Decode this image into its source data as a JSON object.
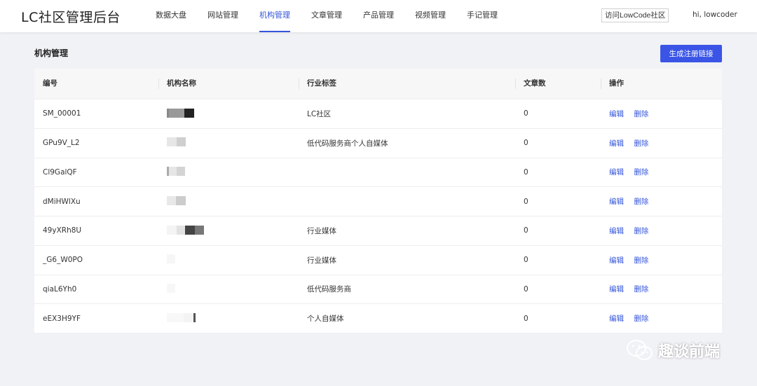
{
  "header": {
    "logo": "LC社区管理后台",
    "nav": [
      "数据大盘",
      "网站管理",
      "机构管理",
      "文章管理",
      "产品管理",
      "视频管理",
      "手记管理"
    ],
    "active_index": 2,
    "visit_button": "访问LowCode社区",
    "greeting": "hi, lowcoder"
  },
  "page": {
    "title": "机构管理",
    "generate_button": "生成注册链接"
  },
  "table": {
    "columns": [
      "编号",
      "机构名称",
      "行业标签",
      "文章数",
      "操作"
    ],
    "rows": [
      {
        "id": "SM_00001",
        "tag": "LC社区",
        "count": "0"
      },
      {
        "id": "GPu9V_L2",
        "tag": "低代码服务商个人自媒体",
        "count": "0"
      },
      {
        "id": "Cl9GalQF",
        "tag": "",
        "count": "0"
      },
      {
        "id": "dMiHWlXu",
        "tag": "",
        "count": "0"
      },
      {
        "id": "49yXRh8U",
        "tag": "行业媒体",
        "count": "0"
      },
      {
        "id": "_G6_W0PO",
        "tag": "行业媒体",
        "count": "0"
      },
      {
        "id": "qiaL6Yh0",
        "tag": "低代码服务商",
        "count": "0"
      },
      {
        "id": "eEX3H9YF",
        "tag": "个人自媒体",
        "count": "0"
      }
    ],
    "edit_label": "编辑",
    "delete_label": "删除"
  },
  "watermark": {
    "text": "趣谈前端",
    "icon": "wechat-icon"
  },
  "colors": {
    "accent": "#3455db",
    "button": "#3a55e6",
    "background": "#f0f2f5"
  }
}
